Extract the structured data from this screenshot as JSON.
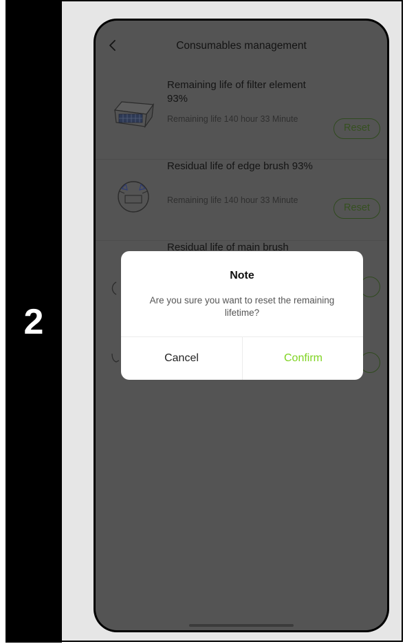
{
  "step_number": "2",
  "screen": {
    "title": "Consumables management",
    "items": [
      {
        "title": "Remaining life of filter element 93%",
        "subtitle": "Remaining life 140 hour 33 Minute",
        "reset_label": "Reset",
        "icon": "filter-element-icon"
      },
      {
        "title": "Residual life of edge brush 93%",
        "subtitle": "Remaining life 140 hour 33 Minute",
        "reset_label": "Reset",
        "icon": "edge-brush-icon"
      },
      {
        "title": "Residual life of main brush",
        "icon": "main-brush-icon"
      }
    ]
  },
  "dialog": {
    "title": "Note",
    "message": "Are you sure you want to reset the remaining lifetime?",
    "cancel_label": "Cancel",
    "confirm_label": "Confirm"
  },
  "colors": {
    "overlay": "#545454",
    "confirm": "#7fd321",
    "reset_text": "#35501f"
  }
}
